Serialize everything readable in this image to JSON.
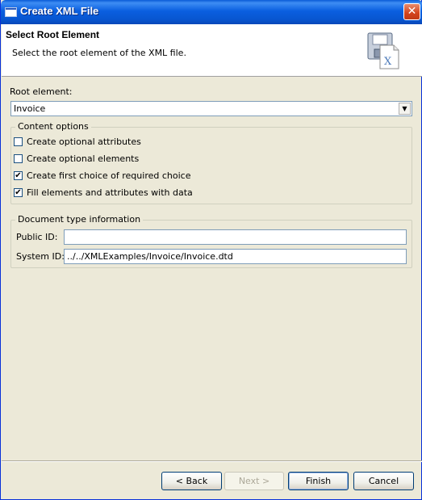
{
  "window": {
    "title": "Create XML File",
    "close_label": "✕"
  },
  "header": {
    "title": "Select Root Element",
    "description": "Select the root element of the XML file."
  },
  "root_element": {
    "label": "Root element:",
    "value": "Invoice"
  },
  "content_options": {
    "title": "Content options",
    "items": [
      {
        "label": "Create optional attributes",
        "checked": false
      },
      {
        "label": "Create optional elements",
        "checked": false
      },
      {
        "label": "Create first choice of required choice",
        "checked": true
      },
      {
        "label": "Fill elements and attributes with data",
        "checked": true
      }
    ]
  },
  "doctype": {
    "title": "Document type information",
    "public_id_label": "Public ID:",
    "public_id_value": "",
    "system_id_label": "System ID:",
    "system_id_value": "../../XMLExamples/Invoice/Invoice.dtd"
  },
  "buttons": {
    "back": "< Back",
    "next": "Next >",
    "finish": "Finish",
    "cancel": "Cancel"
  },
  "icons": {
    "title_icon": "window-icon",
    "header_icon": "xml-file-save-icon",
    "combo_arrow": "chevron-down-icon",
    "check": "✔"
  },
  "colors": {
    "titlebar": "#0a5fe0",
    "dialog_bg": "#ece9d8",
    "field_border": "#7f9db9"
  }
}
